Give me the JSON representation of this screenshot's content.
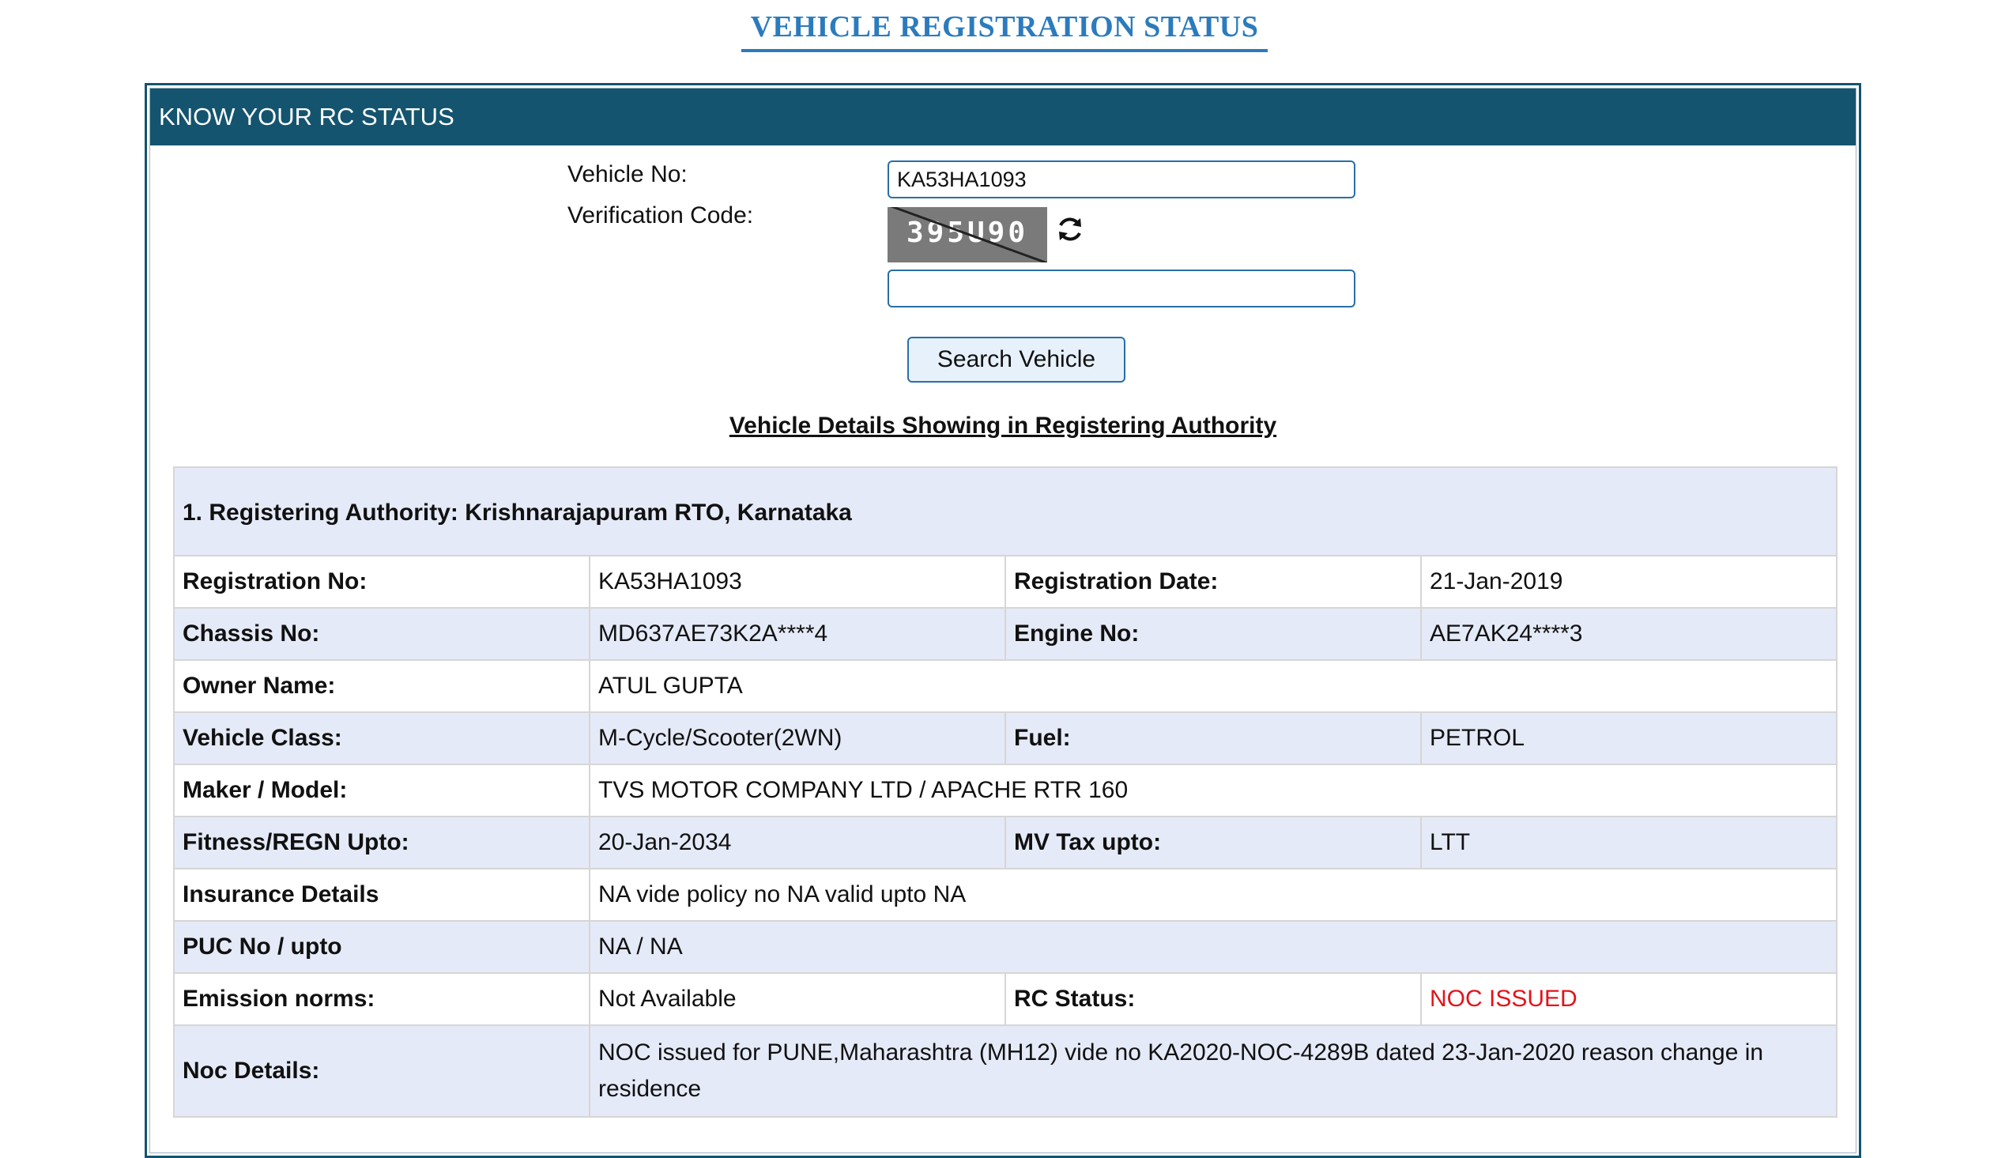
{
  "page": {
    "title": "VEHICLE REGISTRATION STATUS"
  },
  "panel": {
    "header": "KNOW YOUR RC STATUS"
  },
  "form": {
    "vehicle_no_label": "Vehicle No:",
    "vehicle_no_value": "KA53HA1093",
    "verification_label": "Verification Code:",
    "captcha_text": "395U90",
    "verification_value": "",
    "refresh_icon": "refresh-icon",
    "search_button": "Search Vehicle"
  },
  "details": {
    "heading": "Vehicle Details Showing in Registering Authority",
    "authority": "1. Registering Authority: Krishnarajapuram RTO, Karnataka",
    "rows": {
      "registration_no_label": "Registration No:",
      "registration_no": "KA53HA1093",
      "registration_date_label": "Registration Date:",
      "registration_date": "21-Jan-2019",
      "chassis_no_label": "Chassis No:",
      "chassis_no": "MD637AE73K2A****4",
      "engine_no_label": "Engine No:",
      "engine_no": "AE7AK24****3",
      "owner_name_label": "Owner Name:",
      "owner_name": "ATUL GUPTA",
      "vehicle_class_label": "Vehicle Class:",
      "vehicle_class": "M-Cycle/Scooter(2WN)",
      "fuel_label": "Fuel:",
      "fuel": "PETROL",
      "maker_model_label": "Maker / Model:",
      "maker_model": "TVS MOTOR COMPANY LTD / APACHE RTR 160",
      "fitness_label": "Fitness/REGN Upto:",
      "fitness": "20-Jan-2034",
      "mv_tax_label": "MV Tax upto:",
      "mv_tax": "LTT",
      "insurance_label": "Insurance Details",
      "insurance": "NA vide policy no NA valid upto NA",
      "puc_label": "PUC No / upto",
      "puc": "NA / NA",
      "emission_label": "Emission norms:",
      "emission": "Not Available",
      "rc_status_label": "RC Status:",
      "rc_status": "NOC ISSUED",
      "noc_label": "Noc Details:",
      "noc": "NOC issued for PUNE,Maharashtra (MH12) vide no KA2020-NOC-4289B dated 23-Jan-2020 reason change in residence"
    }
  },
  "colors": {
    "title_blue": "#2b7bbd",
    "header_bg": "#14546f",
    "row_shade": "#e5eaf8",
    "status_red": "#e3141b"
  }
}
